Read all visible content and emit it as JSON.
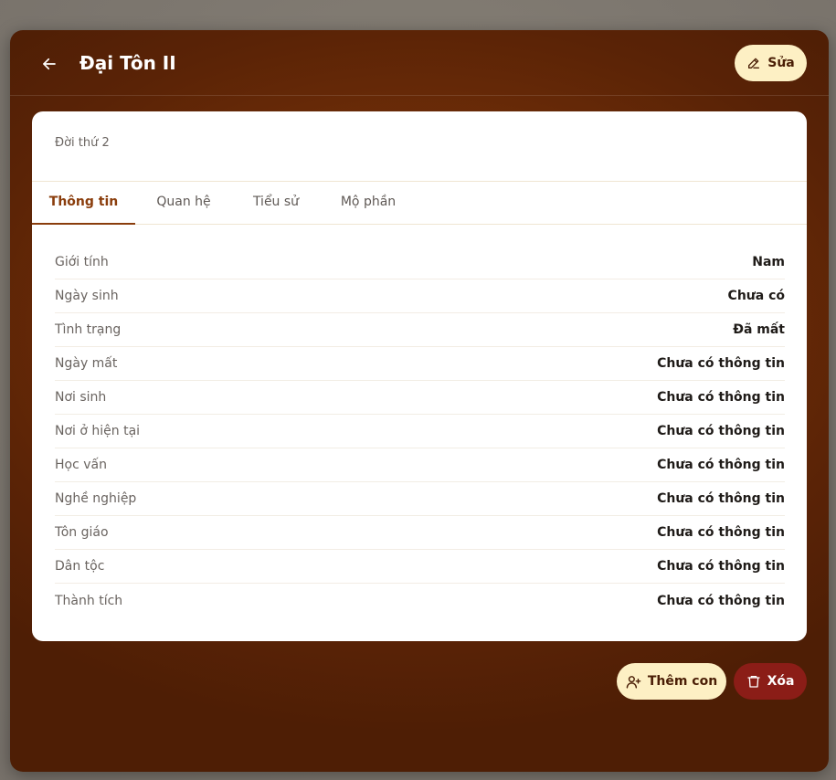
{
  "header": {
    "title": "Đại Tôn II",
    "edit_label": "Sửa",
    "back_icon": "arrow-left-icon",
    "edit_icon": "pencil-icon"
  },
  "card": {
    "generation": "Đời thứ 2"
  },
  "tabs": [
    {
      "label": "Thông tin",
      "active": true
    },
    {
      "label": "Quan hệ",
      "active": false
    },
    {
      "label": "Tiểu sử",
      "active": false
    },
    {
      "label": "Mộ phần",
      "active": false
    }
  ],
  "info_rows": [
    {
      "label": "Giới tính",
      "value": "Nam"
    },
    {
      "label": "Ngày sinh",
      "value": "Chưa có"
    },
    {
      "label": "Tình trạng",
      "value": "Đã mất"
    },
    {
      "label": "Ngày mất",
      "value": "Chưa có thông tin"
    },
    {
      "label": "Nơi sinh",
      "value": "Chưa có thông tin"
    },
    {
      "label": "Nơi ở hiện tại",
      "value": "Chưa có thông tin"
    },
    {
      "label": "Học vấn",
      "value": "Chưa có thông tin"
    },
    {
      "label": "Nghề nghiệp",
      "value": "Chưa có thông tin"
    },
    {
      "label": "Tôn giáo",
      "value": "Chưa có thông tin"
    },
    {
      "label": "Dân tộc",
      "value": "Chưa có thông tin"
    },
    {
      "label": "Thành tích",
      "value": "Chưa có thông tin"
    }
  ],
  "actions": {
    "add_child_label": "Thêm con",
    "delete_label": "Xóa",
    "add_child_icon": "user-plus-icon",
    "delete_icon": "trash-icon"
  },
  "colors": {
    "modal_bg": "#6e2d08",
    "accent": "#8a3d0c",
    "primary_button_bg": "#fdf0c4",
    "danger_button_bg": "#8b1d17"
  }
}
